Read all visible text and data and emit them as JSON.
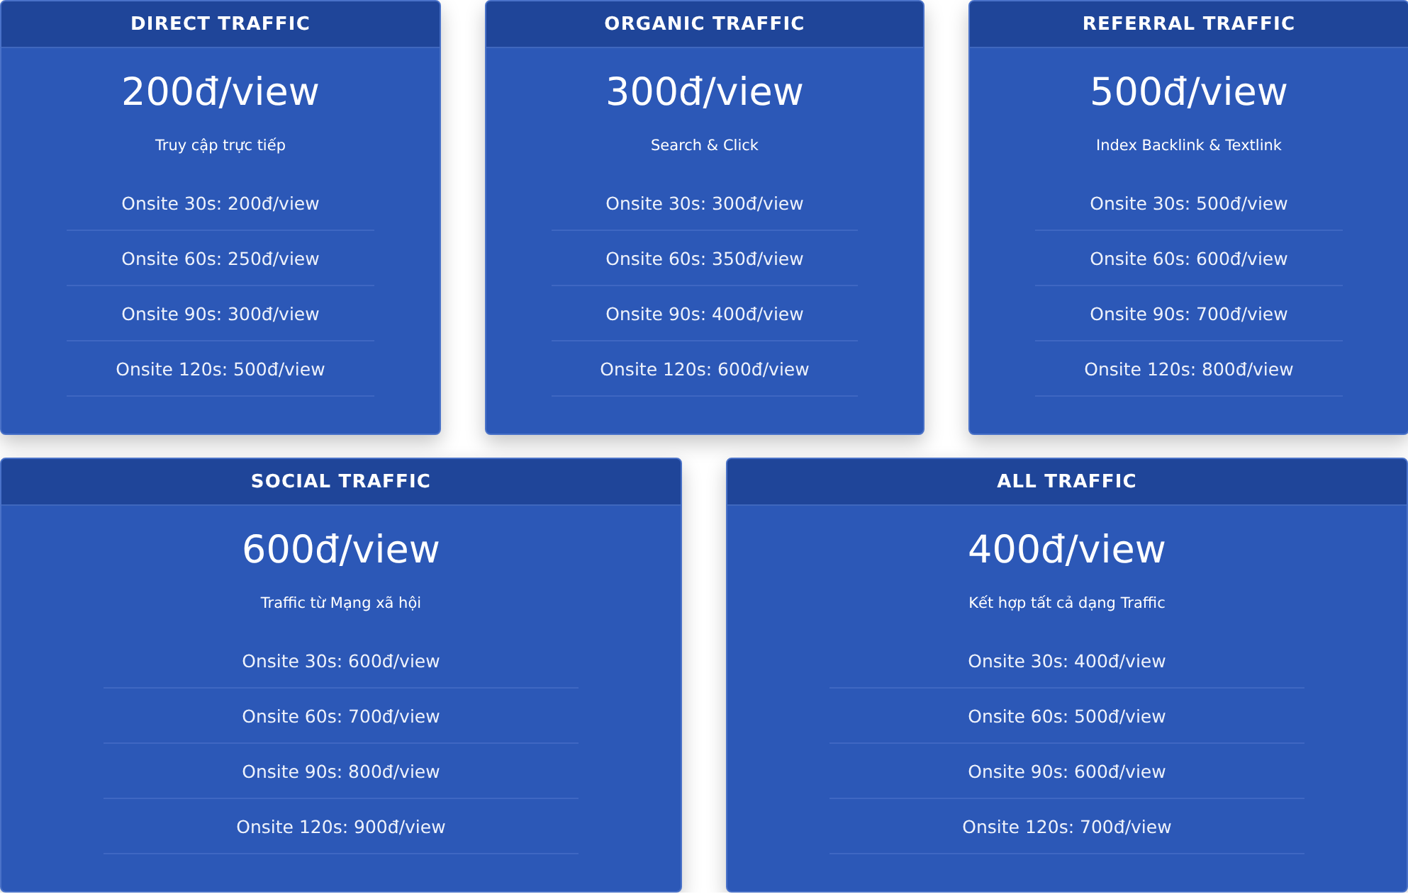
{
  "rows": [
    {
      "cards": [
        {
          "title": "DIRECT TRAFFIC",
          "price": "200đ/view",
          "subtitle": "Truy cập trực tiếp",
          "items": [
            "Onsite 30s: 200đ/view",
            "Onsite 60s: 250đ/view",
            "Onsite 90s: 300đ/view",
            "Onsite 120s: 500đ/view"
          ]
        },
        {
          "title": "ORGANIC TRAFFIC",
          "price": "300đ/view",
          "subtitle": "Search & Click",
          "items": [
            "Onsite 30s: 300đ/view",
            "Onsite 60s: 350đ/view",
            "Onsite 90s: 400đ/view",
            "Onsite 120s: 600đ/view"
          ]
        },
        {
          "title": "REFERRAL TRAFFIC",
          "price": "500đ/view",
          "subtitle": "Index Backlink & Textlink",
          "items": [
            "Onsite 30s: 500đ/view",
            "Onsite 60s: 600đ/view",
            "Onsite 90s: 700đ/view",
            "Onsite 120s: 800đ/view"
          ]
        }
      ]
    },
    {
      "cards": [
        {
          "title": "SOCIAL TRAFFIC",
          "price": "600đ/view",
          "subtitle": "Traffic từ Mạng xã hội",
          "items": [
            "Onsite 30s: 600đ/view",
            "Onsite 60s: 700đ/view",
            "Onsite 90s: 800đ/view",
            "Onsite 120s: 900đ/view"
          ]
        },
        {
          "title": "ALL TRAFFIC",
          "price": "400đ/view",
          "subtitle": "Kết hợp tất cả dạng Traffic",
          "items": [
            "Onsite 30s: 400đ/view",
            "Onsite 60s: 500đ/view",
            "Onsite 90s: 600đ/view",
            "Onsite 120s: 700đ/view"
          ]
        }
      ]
    }
  ]
}
